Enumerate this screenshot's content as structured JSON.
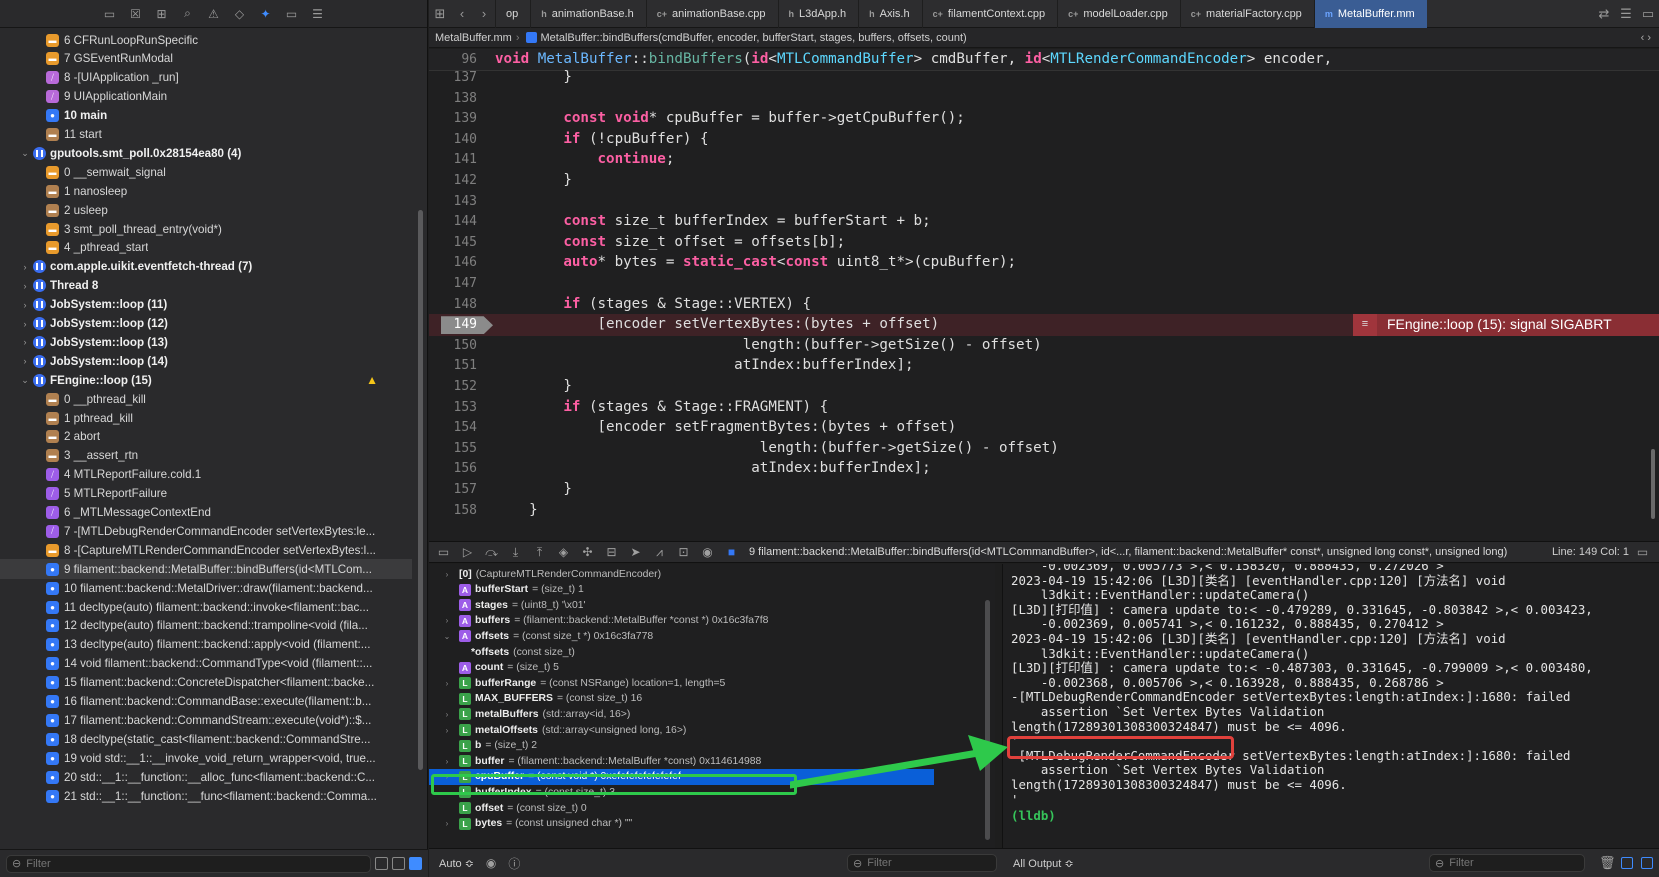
{
  "navigator": {
    "rows": [
      {
        "indent": 2,
        "icon": "orange",
        "label": "6 CFRunLoopRunSpecific"
      },
      {
        "indent": 2,
        "icon": "orange",
        "label": "7 GSEventRunModal"
      },
      {
        "indent": 2,
        "icon": "pink",
        "label": "8 -[UIApplication _run]"
      },
      {
        "indent": 2,
        "icon": "pink",
        "label": "9 UIApplicationMain"
      },
      {
        "indent": 2,
        "icon": "blue",
        "label": "10 main",
        "bold": true
      },
      {
        "indent": 2,
        "icon": "tan",
        "label": "11 start"
      },
      {
        "indent": 1,
        "thread": true,
        "open": true,
        "label": "gputools.smt_poll.0x28154ea80 (4)",
        "bold": true
      },
      {
        "indent": 2,
        "icon": "orange",
        "label": "0 __semwait_signal"
      },
      {
        "indent": 2,
        "icon": "tan",
        "label": "1 nanosleep"
      },
      {
        "indent": 2,
        "icon": "tan",
        "label": "2 usleep"
      },
      {
        "indent": 2,
        "icon": "orange",
        "label": "3 smt_poll_thread_entry(void*)"
      },
      {
        "indent": 2,
        "icon": "orange",
        "label": "4 _pthread_start"
      },
      {
        "indent": 1,
        "thread": true,
        "label": "com.apple.uikit.eventfetch-thread (7)",
        "bold": true
      },
      {
        "indent": 1,
        "thread": true,
        "label": "Thread 8",
        "bold": true
      },
      {
        "indent": 1,
        "thread": true,
        "label": "JobSystem::loop (11)",
        "bold": true
      },
      {
        "indent": 1,
        "thread": true,
        "label": "JobSystem::loop (12)",
        "bold": true
      },
      {
        "indent": 1,
        "thread": true,
        "label": "JobSystem::loop (13)",
        "bold": true
      },
      {
        "indent": 1,
        "thread": true,
        "label": "JobSystem::loop (14)",
        "bold": true
      },
      {
        "indent": 1,
        "thread": true,
        "open": true,
        "label": "FEngine::loop (15)",
        "bold": true,
        "warn": true
      },
      {
        "indent": 2,
        "icon": "tan",
        "label": "0 __pthread_kill"
      },
      {
        "indent": 2,
        "icon": "tan",
        "label": "1 pthread_kill"
      },
      {
        "indent": 2,
        "icon": "tan",
        "label": "2 abort"
      },
      {
        "indent": 2,
        "icon": "tan",
        "label": "3 __assert_rtn"
      },
      {
        "indent": 2,
        "icon": "purple",
        "label": "4 MTLReportFailure.cold.1"
      },
      {
        "indent": 2,
        "icon": "purple",
        "label": "5 MTLReportFailure"
      },
      {
        "indent": 2,
        "icon": "purple",
        "label": "6 _MTLMessageContextEnd"
      },
      {
        "indent": 2,
        "icon": "purple",
        "label": "7 -[MTLDebugRenderCommandEncoder setVertexBytes:le..."
      },
      {
        "indent": 2,
        "icon": "orange",
        "label": "8 -[CaptureMTLRenderCommandEncoder setVertexBytes:l..."
      },
      {
        "indent": 2,
        "icon": "blue",
        "label": "9 filament::backend::MetalBuffer::bindBuffers(id<MTLCom...",
        "selected": true
      },
      {
        "indent": 2,
        "icon": "blue",
        "label": "10 filament::backend::MetalDriver::draw(filament::backend..."
      },
      {
        "indent": 2,
        "icon": "blue",
        "label": "11 decltype(auto) filament::backend::invoke<filament::bac..."
      },
      {
        "indent": 2,
        "icon": "blue",
        "label": "12 decltype(auto) filament::backend::trampoline<void (fila..."
      },
      {
        "indent": 2,
        "icon": "blue",
        "label": "13 decltype(auto) filament::backend::apply<void (filament:..."
      },
      {
        "indent": 2,
        "icon": "blue",
        "label": "14 void filament::backend::CommandType<void (filament::..."
      },
      {
        "indent": 2,
        "icon": "blue",
        "label": "15 filament::backend::ConcreteDispatcher<filament::backe..."
      },
      {
        "indent": 2,
        "icon": "blue",
        "label": "16 filament::backend::CommandBase::execute(filament::b..."
      },
      {
        "indent": 2,
        "icon": "blue",
        "label": "17 filament::backend::CommandStream::execute(void*)::$..."
      },
      {
        "indent": 2,
        "icon": "blue",
        "label": "18 decltype(static_cast<filament::backend::CommandStre..."
      },
      {
        "indent": 2,
        "icon": "blue",
        "label": "19 void std::__1::__invoke_void_return_wrapper<void, true..."
      },
      {
        "indent": 2,
        "icon": "blue",
        "label": "20 std::__1::__function::__alloc_func<filament::backend::C..."
      },
      {
        "indent": 2,
        "icon": "blue",
        "label": "21 std::__1::__function::__func<filament::backend::Comma..."
      }
    ],
    "filter_placeholder": "Filter"
  },
  "tabs": [
    {
      "icon": "",
      "label": "op"
    },
    {
      "icon": "h",
      "label": "animationBase.h"
    },
    {
      "icon": "c+",
      "label": "animationBase.cpp"
    },
    {
      "icon": "h",
      "label": "L3dApp.h"
    },
    {
      "icon": "h",
      "label": "Axis.h"
    },
    {
      "icon": "c+",
      "label": "filamentContext.cpp"
    },
    {
      "icon": "c+",
      "label": "modelLoader.cpp"
    },
    {
      "icon": "c+",
      "label": "materialFactory.cpp"
    },
    {
      "icon": "m",
      "label": "MetalBuffer.mm",
      "active": true
    }
  ],
  "jumpbar": {
    "file": "MetalBuffer.mm",
    "symbol": "MetalBuffer::bindBuffers(cmdBuffer, encoder, bufferStart, stages, buffers, offsets, count)"
  },
  "editor": {
    "sticky_line": {
      "num": "96",
      "html": "<span class=\"kw\">void</span> <span class=\"cls\">MetalBuffer</span>::<span class=\"fn\">bindBuffers</span>(<span class=\"kw\">id</span>&lt;<span class=\"ty\">MTLCommandBuffer</span>&gt; cmdBuffer, <span class=\"kw\">id</span>&lt;<span class=\"ty\">MTLRenderCommandEncoder</span>&gt; encoder,"
    },
    "lines": [
      {
        "num": "137",
        "html": "        }"
      },
      {
        "num": "138",
        "html": ""
      },
      {
        "num": "139",
        "html": "        <span class=\"kw\">const</span> <span class=\"kw\">void</span>* cpuBuffer = buffer-&gt;getCpuBuffer();"
      },
      {
        "num": "140",
        "html": "        <span class=\"kw\">if</span> (!cpuBuffer) {"
      },
      {
        "num": "141",
        "html": "            <span class=\"kw\">continue</span>;"
      },
      {
        "num": "142",
        "html": "        }"
      },
      {
        "num": "143",
        "html": ""
      },
      {
        "num": "144",
        "html": "        <span class=\"kw\">const</span> size_t bufferIndex = bufferStart + b;"
      },
      {
        "num": "145",
        "html": "        <span class=\"kw\">const</span> size_t offset = offsets[b];"
      },
      {
        "num": "146",
        "html": "        <span class=\"kw\">auto</span>* bytes = <span class=\"kw\">static_cast</span>&lt;<span class=\"kw\">const</span> uint8_t*&gt;(cpuBuffer);"
      },
      {
        "num": "147",
        "html": ""
      },
      {
        "num": "148",
        "html": "        <span class=\"kw\">if</span> (stages &amp; Stage::VERTEX) {"
      },
      {
        "num": "149",
        "html": "            [encoder setVertexBytes:(bytes + offset)",
        "error": true
      },
      {
        "num": "150",
        "html": "                             length:(buffer-&gt;getSize() - offset)"
      },
      {
        "num": "151",
        "html": "                            atIndex:bufferIndex];"
      },
      {
        "num": "152",
        "html": "        }"
      },
      {
        "num": "153",
        "html": "        <span class=\"kw\">if</span> (stages &amp; Stage::FRAGMENT) {"
      },
      {
        "num": "154",
        "html": "            [encoder setFragmentBytes:(bytes + offset)"
      },
      {
        "num": "155",
        "html": "                               length:(buffer-&gt;getSize() - offset)"
      },
      {
        "num": "156",
        "html": "                              atIndex:bufferIndex];"
      },
      {
        "num": "157",
        "html": "        }"
      },
      {
        "num": "158",
        "html": "    }"
      }
    ],
    "error_message": "FEngine::loop (15): signal SIGABRT"
  },
  "debugbar": {
    "frame": "9 filament::backend::MetalBuffer::bindBuffers(id<MTLCommandBuffer>, id<...r, filament::backend::MetalBuffer* const*, unsigned long const*, unsigned long)",
    "linecol": "Line: 149  Col: 1"
  },
  "variables": [
    {
      "disc": "›",
      "icon": "N",
      "name": "[0]",
      "value": "(CaptureMTLRenderCommandEncoder)"
    },
    {
      "disc": "",
      "icon": "A",
      "name": "bufferStart",
      "value": "= (size_t) 1"
    },
    {
      "disc": "",
      "icon": "A",
      "name": "stages",
      "value": "= (uint8_t) '\\x01'"
    },
    {
      "disc": "›",
      "icon": "A",
      "name": "buffers",
      "value": "= (filament::backend::MetalBuffer *const *) 0x16c3fa7f8"
    },
    {
      "disc": "⌄",
      "icon": "A",
      "name": "offsets",
      "value": "= (const size_t *) 0x16c3fa778"
    },
    {
      "disc": "",
      "icon": "N",
      "name": "*offsets",
      "value": "(const size_t)",
      "sub": true
    },
    {
      "disc": "",
      "icon": "A",
      "name": "count",
      "value": "= (size_t) 5"
    },
    {
      "disc": "›",
      "icon": "L",
      "name": "bufferRange",
      "value": "= (const NSRange) location=1, length=5"
    },
    {
      "disc": "",
      "icon": "L",
      "name": "MAX_BUFFERS",
      "value": "= (const size_t) 16"
    },
    {
      "disc": "›",
      "icon": "L",
      "name": "metalBuffers",
      "value": "(std::array<id, 16>)"
    },
    {
      "disc": "›",
      "icon": "L",
      "name": "metalOffsets",
      "value": "(std::array<unsigned long, 16>)"
    },
    {
      "disc": "",
      "icon": "L",
      "name": "b",
      "value": "= (size_t) 2"
    },
    {
      "disc": "›",
      "icon": "L",
      "name": "buffer",
      "value": "= (filament::backend::MetalBuffer *const) 0x114614988"
    },
    {
      "disc": "›",
      "icon": "L",
      "name": "cpuBuffer",
      "value": "= (const void *) 0xefefefefefefefef",
      "selected": true
    },
    {
      "disc": "",
      "icon": "L",
      "name": "bufferIndex",
      "value": "= (const size_t) 3"
    },
    {
      "disc": "",
      "icon": "L",
      "name": "offset",
      "value": "= (const size_t) 0"
    },
    {
      "disc": "›",
      "icon": "L",
      "name": "bytes",
      "value": "= (const unsigned char *) \"\""
    }
  ],
  "console": {
    "lines": [
      "    -0.002369, 0.005773 >,< 0.158320, 0.888435, 0.272026 >",
      "2023-04-19 15:42:06 [L3D][类名] [eventHandler.cpp:120] [方法名] void",
      "    l3dkit::EventHandler::updateCamera()",
      "[L3D][打印值] : camera update to:< -0.479289, 0.331645, -0.803842 >,< 0.003423,",
      "    -0.002369, 0.005741 >,< 0.161232, 0.888435, 0.270412 >",
      "2023-04-19 15:42:06 [L3D][类名] [eventHandler.cpp:120] [方法名] void",
      "    l3dkit::EventHandler::updateCamera()",
      "[L3D][打印值] : camera update to:< -0.487303, 0.331645, -0.799009 >,< 0.003480,",
      "    -0.002368, 0.005706 >,< 0.163928, 0.888435, 0.268786 >",
      "-[MTLDebugRenderCommandEncoder setVertexBytes:length:atIndex:]:1680: failed",
      "    assertion `Set Vertex Bytes Validation",
      "length(17289301308300324847) must be <= 4096.",
      "'",
      "-[MTLDebugRenderCommandEncoder setVertexBytes:length:atIndex:]:1680: failed",
      "    assertion `Set Vertex Bytes Validation",
      "length(17289301308300324847) must be <= 4096.",
      "'"
    ],
    "prompt": "(lldb)"
  },
  "bottombar": {
    "auto_label": "Auto ≎",
    "vars_filter_placeholder": "Filter",
    "output_label": "All Output ≎",
    "console_filter_placeholder": "Filter"
  },
  "colors": {
    "accent": "#3f8cff",
    "error_banner": "#8a2e34",
    "selection": "#0a5fd8",
    "annotation_green": "#2ec94b",
    "annotation_red": "#e0413c"
  }
}
